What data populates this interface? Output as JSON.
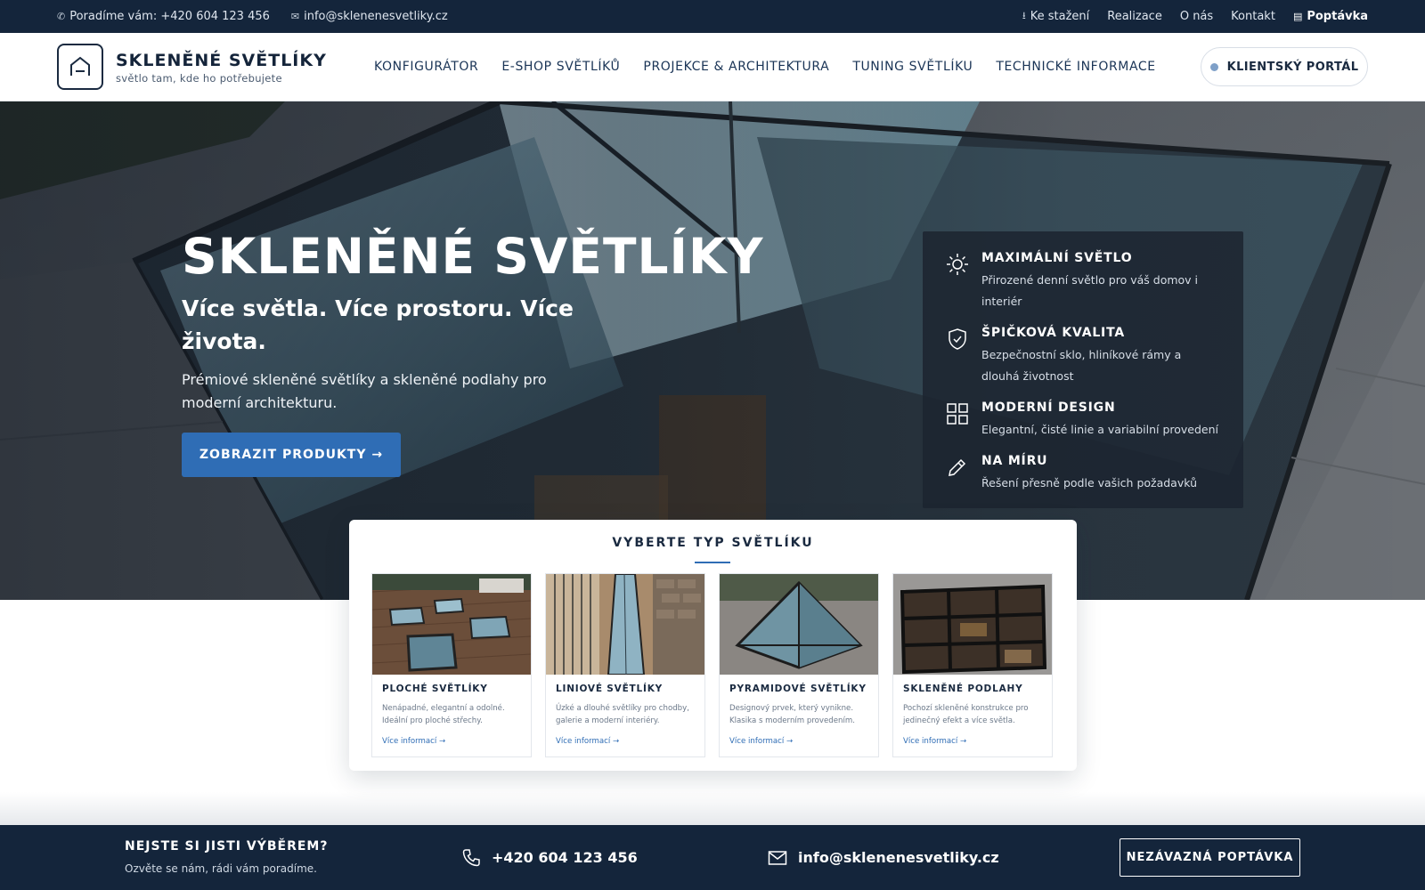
{
  "topbar": {
    "phone": "Poradíme vám: +420 604 123 456",
    "email": "info@sklenenesvetliky.cz",
    "links": [
      {
        "icon": "download-icon",
        "label": "Ke stažení"
      },
      {
        "label": "Realizace"
      },
      {
        "label": "O nás"
      },
      {
        "label": "Kontakt"
      },
      {
        "icon": "inbox-icon",
        "label": "Poptávka"
      }
    ]
  },
  "header": {
    "brand_name": "SKLENĚNÉ SVĚTLÍKY",
    "brand_tagline": "světlo tam, kde ho potřebujete",
    "nav": [
      "KONFIGURÁTOR",
      "E-SHOP SVĚTLÍKŮ",
      "PROJEKCE & ARCHITEKTURA",
      "TUNING SVĚTLÍKU",
      "TECHNICKÉ INFORMACE"
    ],
    "portal_label": "KLIENTSKÝ PORTÁL"
  },
  "hero": {
    "title": "SKLENĚNÉ SVĚTLÍKY",
    "subtitle": "Více světla. Více prostoru. Více života.",
    "description": "Prémiové skleněné světlíky a skleněné podlahy pro moderní architekturu.",
    "button_label": "ZOBRAZIT PRODUKTY →"
  },
  "features": [
    {
      "icon": "sun-icon",
      "title": "MAXIMÁLNÍ SVĚTLO",
      "text": "Přirozené denní světlo pro váš domov i interiér"
    },
    {
      "icon": "shield-check-icon",
      "title": "ŠPIČKOVÁ KVALITA",
      "text": "Bezpečnostní sklo, hliníkové rámy a dlouhá životnost"
    },
    {
      "icon": "grid-icon",
      "title": "MODERNÍ DESIGN",
      "text": "Elegantní, čisté linie a variabilní provedení"
    },
    {
      "icon": "pencil-icon",
      "title": "NA MÍRU",
      "text": "Řešení přesně podle vašich požadavků"
    }
  ],
  "categories": {
    "title": "VYBERTE TYP SVĚTLÍKU",
    "items": [
      {
        "title": "PLOCHÉ SVĚTLÍKY",
        "text": "Nenápadné, elegantní a odolné. Ideální pro ploché střechy.",
        "link": "Více informací →"
      },
      {
        "title": "LINIOVÉ SVĚTLÍKY",
        "text": "Úzké a dlouhé světlíky pro chodby, galerie a moderní interiéry.",
        "link": "Více informací →"
      },
      {
        "title": "PYRAMIDOVÉ SVĚTLÍKY",
        "text": "Designový prvek, který vynikne. Klasika s moderním provedením.",
        "link": "Více informací →"
      },
      {
        "title": "SKLENĚNÉ PODLAHY",
        "text": "Pochozí skleněné konstrukce pro jedinečný efekt a více světla.",
        "link": "Více informací →"
      }
    ]
  },
  "footer": {
    "question": "NEJSTE SI JISTI VÝBĚREM?",
    "question_sub": "Ozvěte se nám, rádi vám poradíme.",
    "phone": "+420 604 123 456",
    "email": "info@sklenenesvetliky.cz",
    "cta_label": "NEZÁVAZNÁ POPTÁVKA"
  },
  "colors": {
    "navy": "#14253b",
    "accent": "#2f6db5"
  }
}
